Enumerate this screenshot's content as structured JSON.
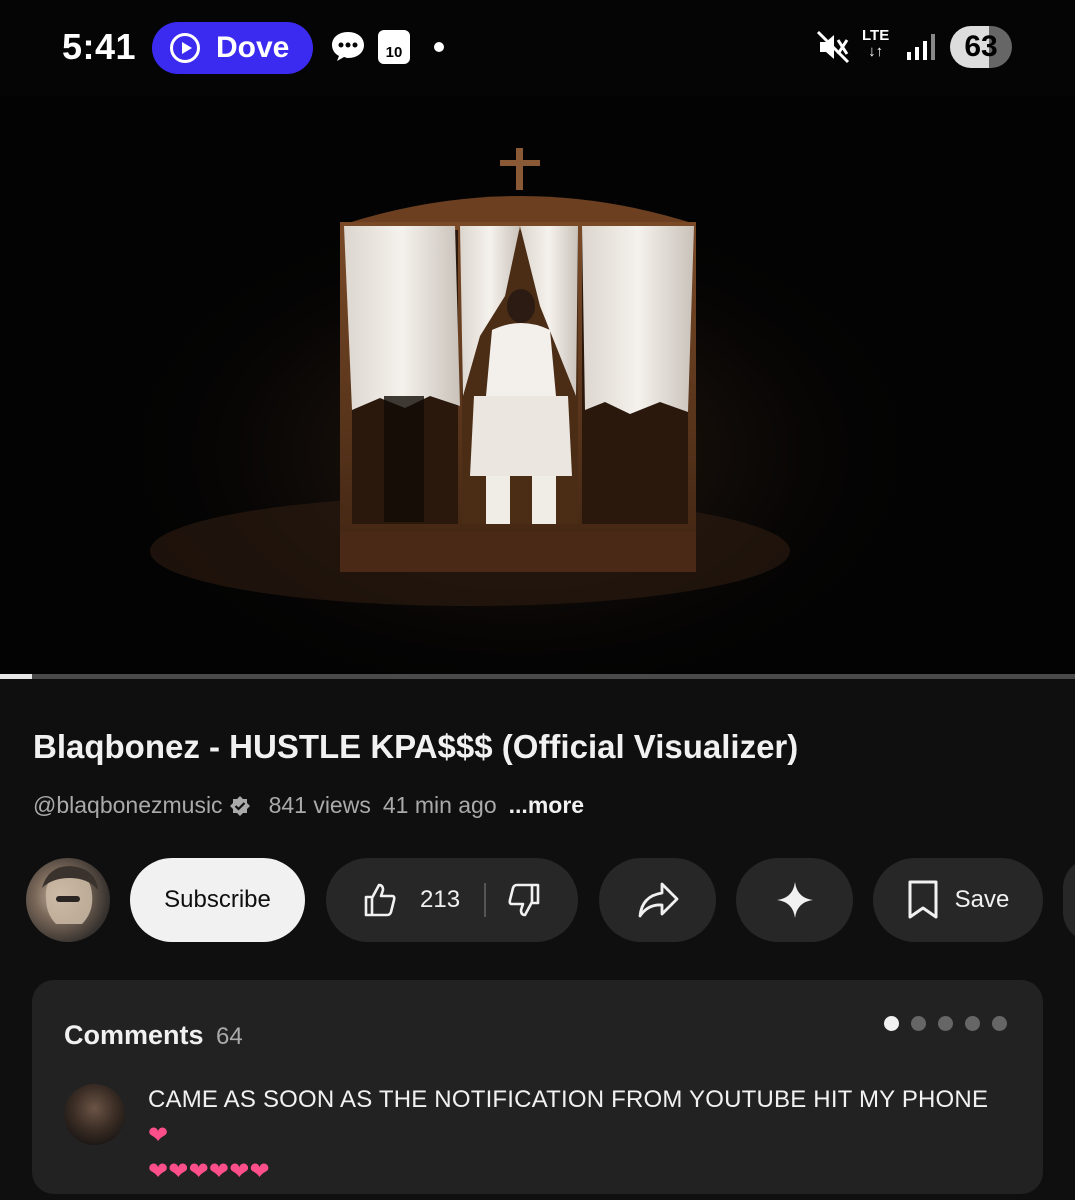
{
  "status_bar": {
    "time": "5:41",
    "app_pill": {
      "label": "Dove",
      "color": "#3b2bf0",
      "icon": "play-circle-icon"
    },
    "calendar_day": "10",
    "network": "LTE",
    "battery": "63",
    "icons": [
      "message-icon",
      "calendar-icon",
      "notification-dot-icon",
      "mute-icon",
      "lte-icon",
      "signal-icon",
      "battery-icon"
    ]
  },
  "video": {
    "progress_fraction": 0.03
  },
  "video_info": {
    "title": "Blaqbonez - HUSTLE KPA$$$ (Official Visualizer)",
    "channel": "@blaqbonezmusic",
    "views": "841 views",
    "age": "41 min ago",
    "more": "...more"
  },
  "actions": {
    "subscribe": "Subscribe",
    "likes": "213",
    "save": "Save",
    "icons": [
      "thumbs-up-icon",
      "thumbs-down-icon",
      "share-icon",
      "sparkle-icon",
      "bookmark-icon"
    ]
  },
  "comments": {
    "title": "Comments",
    "count": "64",
    "pager_total": 5,
    "pager_active": 1,
    "top_comment": {
      "text": "CAME AS SOON AS THE NOTIFICATION FROM YOUTUBE HIT MY PHONE",
      "emoji_line1": "❤",
      "emoji_line2": "❤❤❤❤❤❤"
    }
  },
  "colors": {
    "background": "#0f0f0f",
    "button_bg": "#272727",
    "subscribe_bg": "#f1f1f1",
    "comment_panel": "#222222",
    "heart": "#ff4f8b"
  }
}
